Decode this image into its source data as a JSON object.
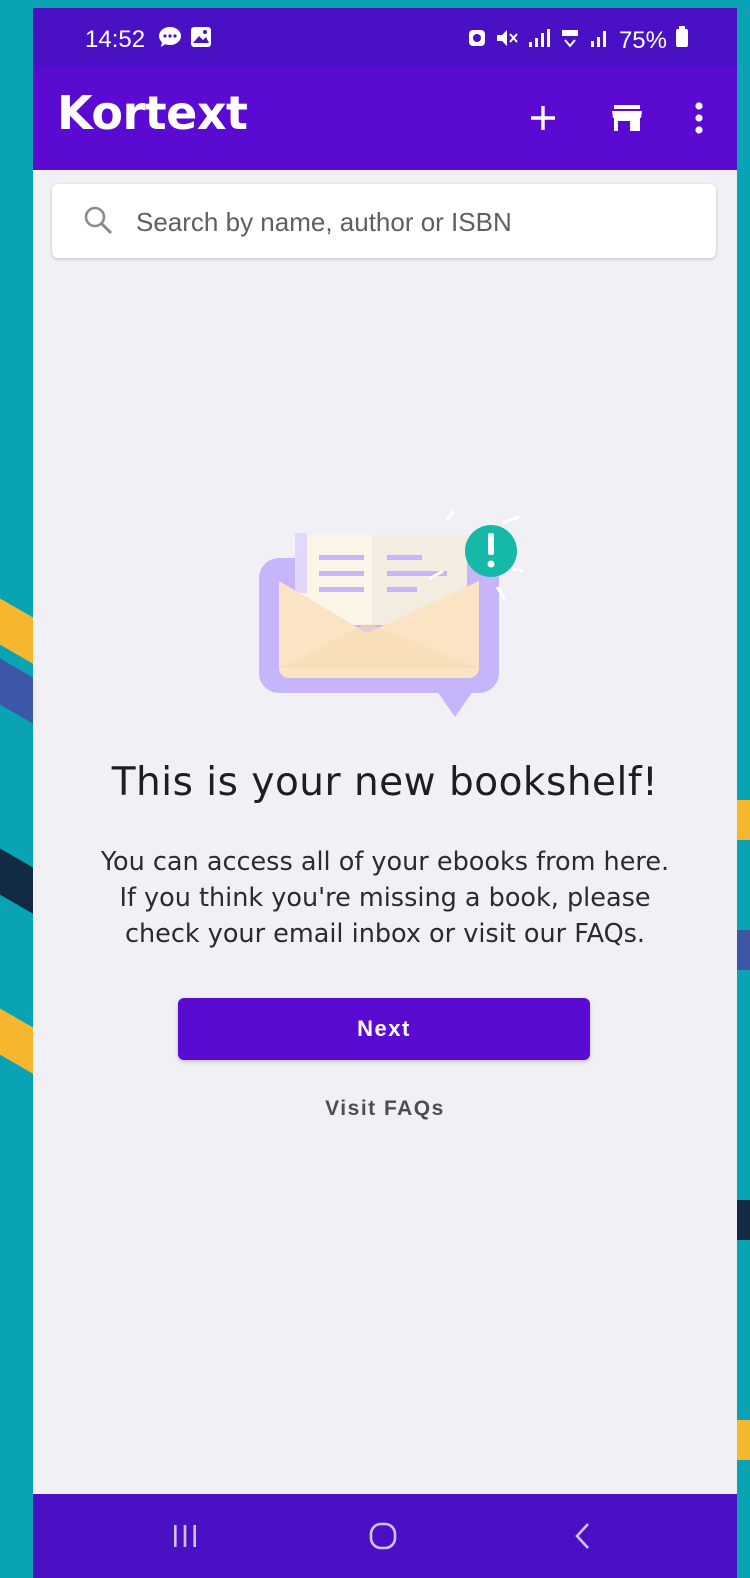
{
  "status_bar": {
    "time": "14:52",
    "battery": "75%",
    "icons": [
      "message-icon",
      "gallery-icon",
      "alarm-icon",
      "mute-icon",
      "signal-icon",
      "4g-icon",
      "signal-icon",
      "battery-icon"
    ]
  },
  "app_bar": {
    "logo": "Kortext",
    "actions": [
      "plus-icon",
      "store-icon",
      "more-vert-icon"
    ]
  },
  "search": {
    "placeholder": "Search by name, author or ISBN"
  },
  "empty_state": {
    "illustration": "envelope-notification-icon",
    "title": "This is your new bookshelf!",
    "lines": [
      "You can access all of your ebooks from here.",
      "If you think you're missing a book, please",
      "check your email inbox or visit our FAQs."
    ],
    "primary_button": "Next",
    "secondary_link": "Visit FAQs"
  },
  "nav_bar": {
    "items": [
      "recent-apps-icon",
      "home-icon",
      "back-icon"
    ]
  },
  "colors": {
    "primary": "#5b0bd1",
    "status_bar": "#4a10c4",
    "background": "#f1f0f5",
    "accent": "#16b8a8",
    "outer_background": "#0aa3b4"
  }
}
